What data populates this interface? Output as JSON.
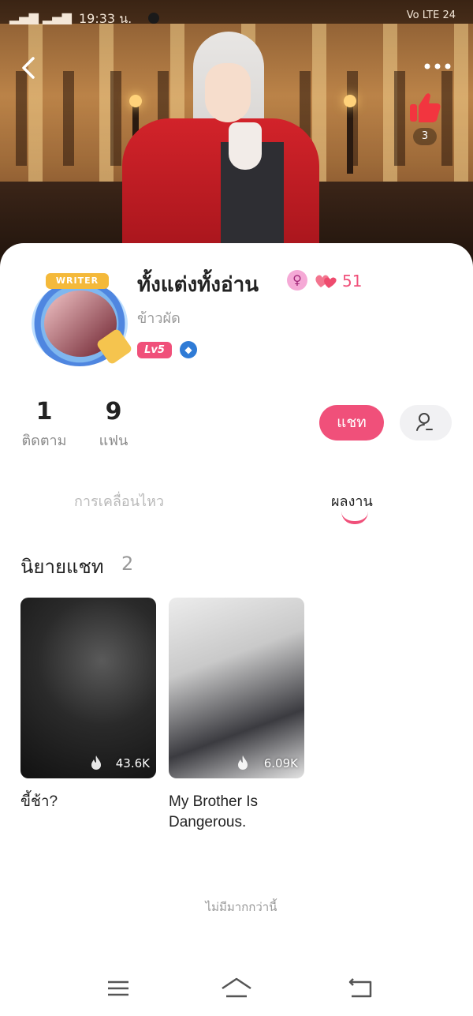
{
  "status_bar": {
    "signal": "▂▄▆ ▂▄▆",
    "time": "19:33 น.",
    "right": "Vo LTE 24"
  },
  "header": {
    "back_icon": "chevron-left-icon",
    "more_icon": "more-dots-icon",
    "like_icon": "thumbs-up-icon",
    "like_count": "3"
  },
  "profile": {
    "avatar_badge": "WRITER",
    "name": "ทั้งแต่งทั้งอ่าน",
    "gender_symbol": "♀",
    "hearts_count": "51",
    "subname": "ข้าวผัด",
    "level": "Lv5",
    "shield_symbol": "◆"
  },
  "stats": [
    {
      "value": "1",
      "label": "ติดตาม"
    },
    {
      "value": "9",
      "label": "แฟน"
    }
  ],
  "actions": {
    "chat_label": "แชท",
    "profile_icon": "user-edit-icon"
  },
  "tabs": [
    {
      "label": "การเคลื่อนไหว",
      "active": false
    },
    {
      "label": "ผลงาน",
      "active": true
    }
  ],
  "section": {
    "title": "นิยายแชท",
    "count": "2"
  },
  "novels": [
    {
      "title": "ขี้ช้า?",
      "views": "43.6K"
    },
    {
      "title": "My Brother Is Dangerous.",
      "views": "6.09K"
    }
  ],
  "footer": {
    "no_more": "ไม่มีมากกว่านี้"
  },
  "colors": {
    "accent": "#f0507a",
    "text": "#222222",
    "muted": "#999999"
  }
}
